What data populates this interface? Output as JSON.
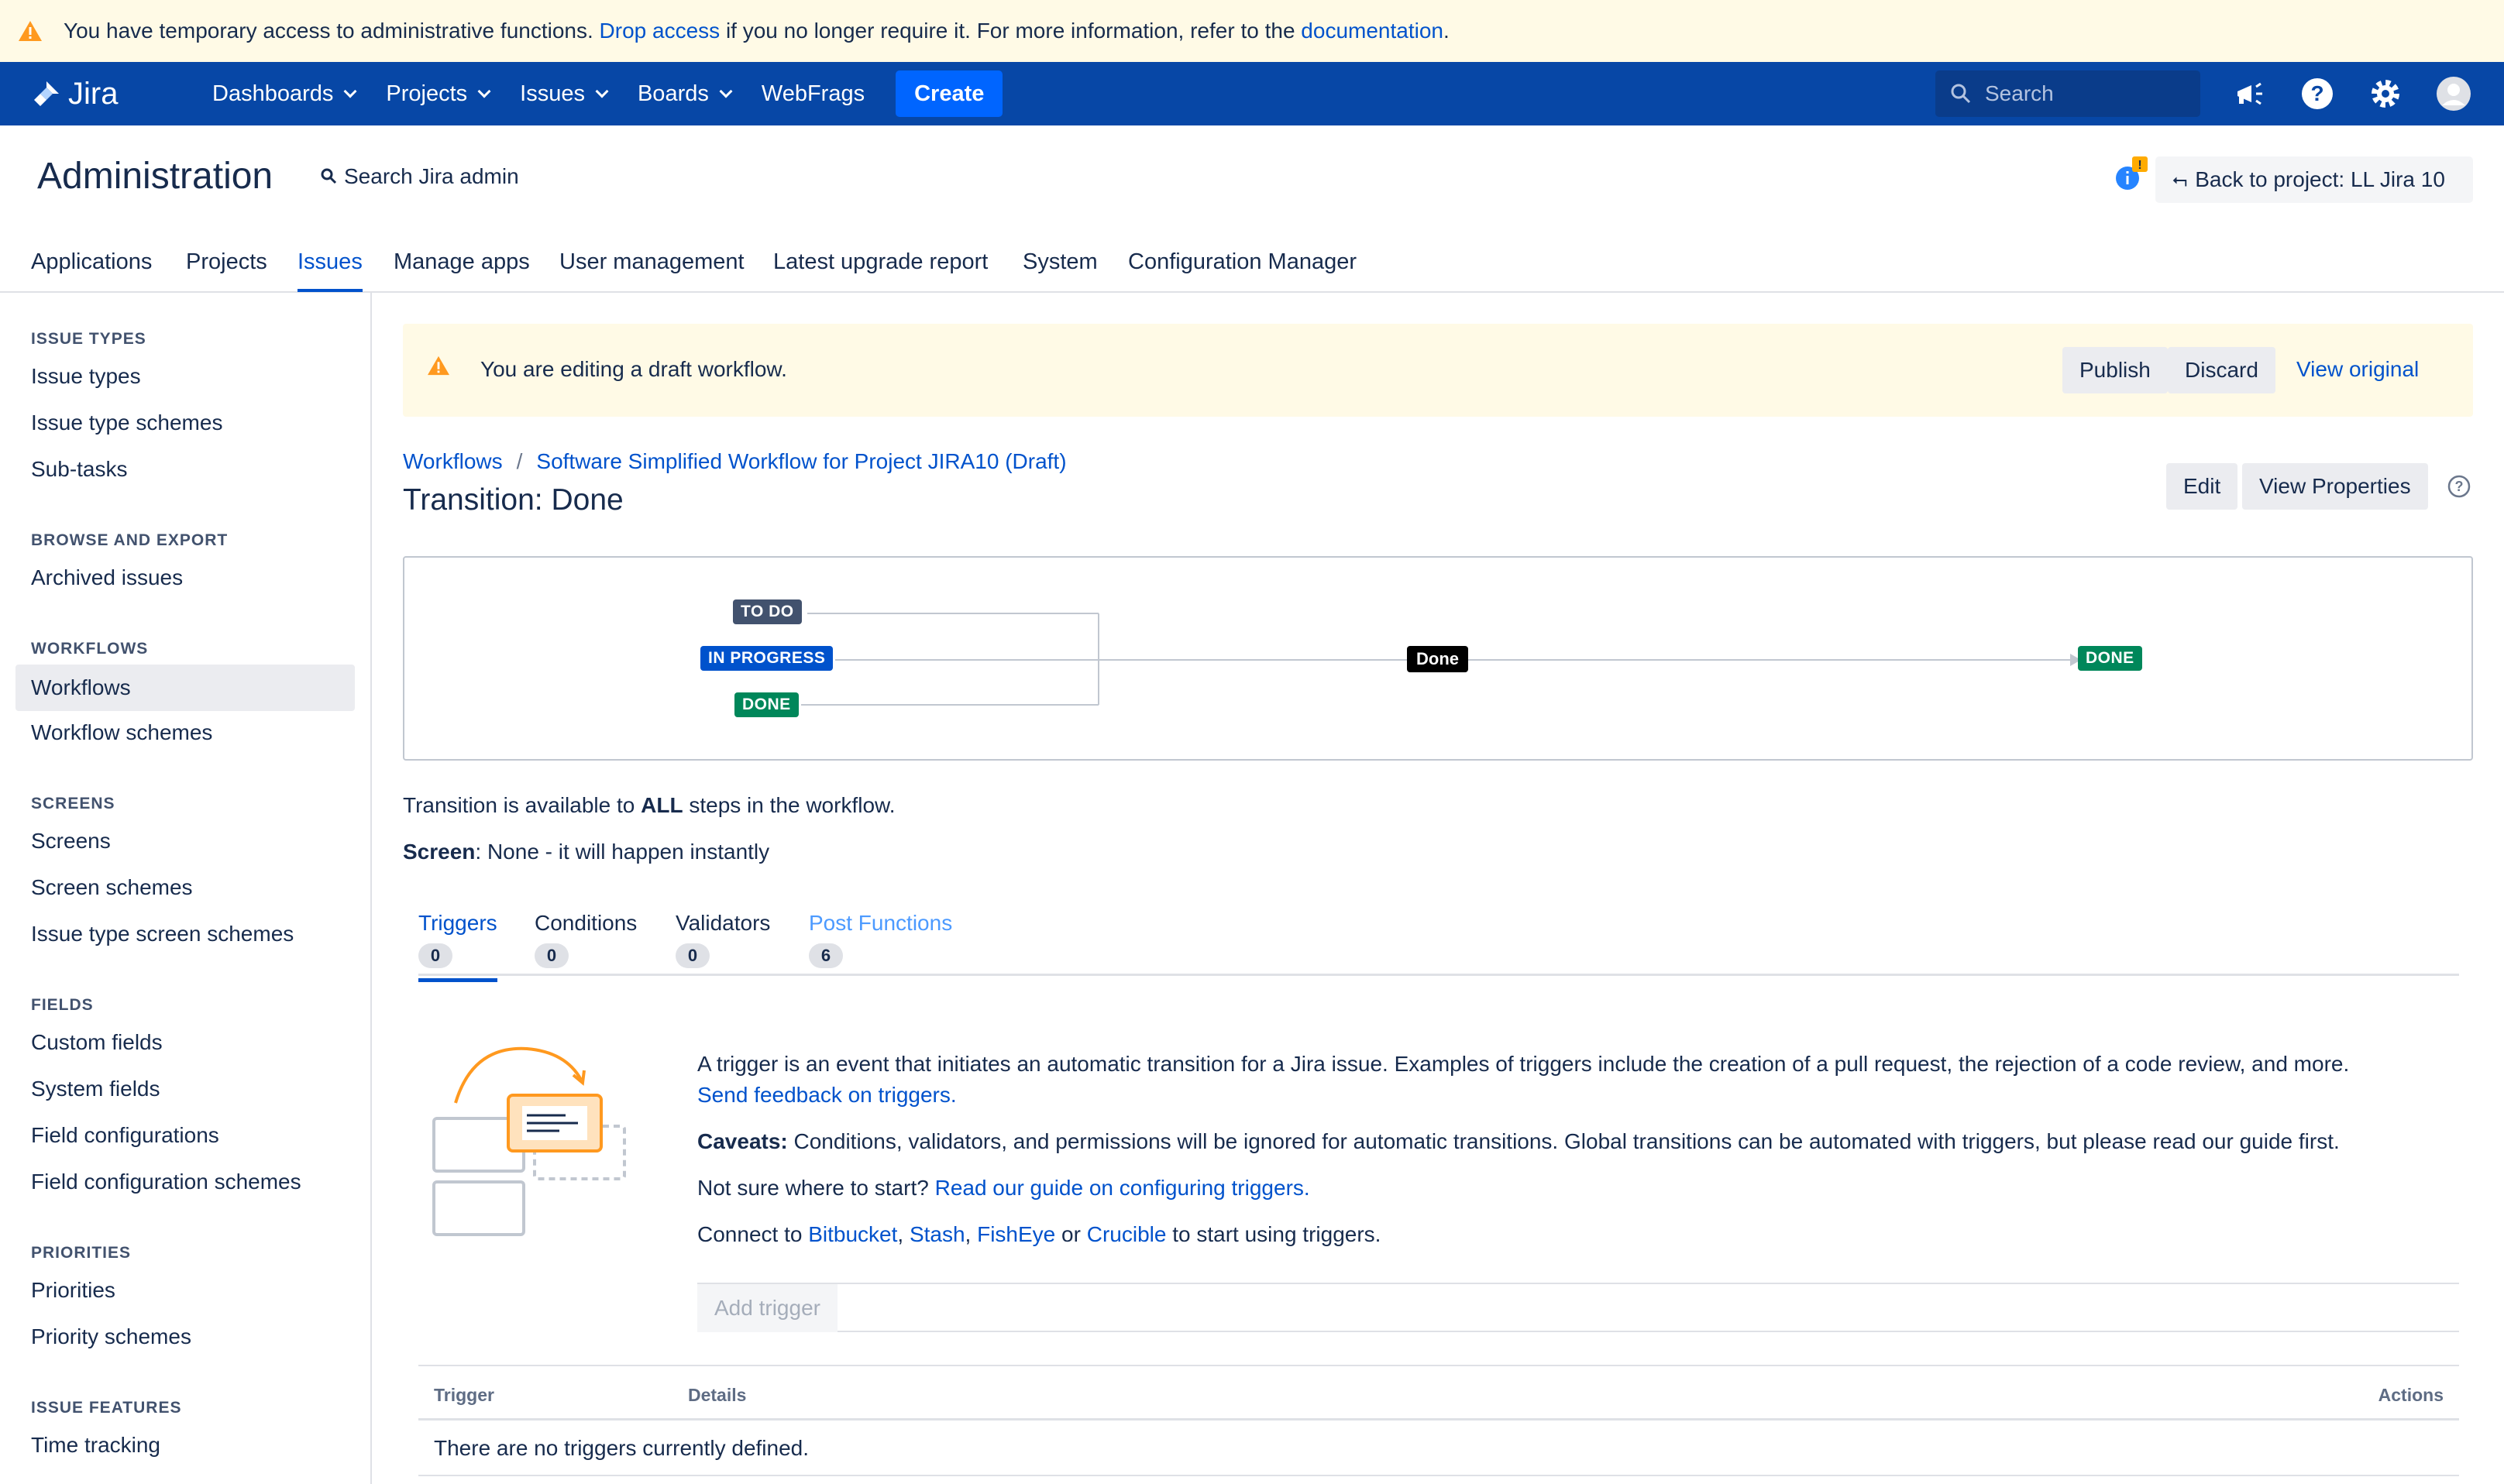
{
  "banner": {
    "text_before": "You have temporary access to administrative functions.",
    "link1": "Drop access",
    "text_middle": "if you no longer require it. For more information, refer to the",
    "link2": "documentation",
    "text_after": "."
  },
  "topnav": {
    "logo_text": "Jira",
    "items": [
      {
        "label": "Dashboards",
        "dropdown": true
      },
      {
        "label": "Projects",
        "dropdown": true
      },
      {
        "label": "Issues",
        "dropdown": true
      },
      {
        "label": "Boards",
        "dropdown": true
      },
      {
        "label": "WebFrags",
        "dropdown": false
      }
    ],
    "create_label": "Create",
    "search_placeholder": "Search",
    "icons": [
      "megaphone-icon",
      "help-icon",
      "settings-icon",
      "avatar"
    ]
  },
  "admin": {
    "title": "Administration",
    "search_label": "Search Jira admin",
    "notif_badge": "!",
    "back_button": "Back to project: LL Jira 10",
    "tabs": [
      "Applications",
      "Projects",
      "Issues",
      "Manage apps",
      "User management",
      "Latest upgrade report",
      "System",
      "Configuration Manager"
    ],
    "active_tab": "Issues"
  },
  "sidebar": {
    "sections": [
      {
        "heading": "ISSUE TYPES",
        "items": [
          "Issue types",
          "Issue type schemes",
          "Sub-tasks"
        ]
      },
      {
        "heading": "BROWSE AND EXPORT",
        "items": [
          "Archived issues"
        ]
      },
      {
        "heading": "WORKFLOWS",
        "items": [
          "Workflows",
          "Workflow schemes"
        ]
      },
      {
        "heading": "SCREENS",
        "items": [
          "Screens",
          "Screen schemes",
          "Issue type screen schemes"
        ]
      },
      {
        "heading": "FIELDS",
        "items": [
          "Custom fields",
          "System fields",
          "Field configurations",
          "Field configuration schemes"
        ]
      },
      {
        "heading": "PRIORITIES",
        "items": [
          "Priorities",
          "Priority schemes"
        ]
      },
      {
        "heading": "ISSUE FEATURES",
        "items": [
          "Time tracking"
        ]
      }
    ],
    "active_item": "Workflows"
  },
  "draft": {
    "message": "You are editing a draft workflow.",
    "publish": "Publish",
    "discard": "Discard",
    "view_original": "View original"
  },
  "breadcrumb": {
    "root": "Workflows",
    "separator": "/",
    "current": "Software Simplified Workflow for Project JIRA10 (Draft)"
  },
  "page_title": "Transition: Done",
  "header_buttons": {
    "edit": "Edit",
    "view_properties": "View Properties"
  },
  "diagram": {
    "from_statuses": [
      "TO DO",
      "IN PROGRESS",
      "DONE"
    ],
    "transition": "Done",
    "to_status": "DONE",
    "colors": {
      "todo": "#42526e",
      "in_progress": "#0052cc",
      "done": "#00875a"
    }
  },
  "availability": {
    "before": "Transition is available to",
    "bold": "ALL",
    "after": "steps in the workflow."
  },
  "screen": {
    "label": "Screen",
    "value": ": None - it will happen instantly"
  },
  "tabs": [
    {
      "label": "Triggers",
      "count": "0",
      "state": "active"
    },
    {
      "label": "Conditions",
      "count": "0",
      "state": "normal"
    },
    {
      "label": "Validators",
      "count": "0",
      "state": "normal"
    },
    {
      "label": "Post Functions",
      "count": "6",
      "state": "hover"
    }
  ],
  "triggers": {
    "intro": "A trigger is an event that initiates an automatic transition for a Jira issue. Examples of triggers include the creation of a pull request, the rejection of a code review, and more.",
    "feedback_link": "Send feedback on triggers.",
    "caveats_label": "Caveats:",
    "caveats_text": "Conditions, validators, and permissions will be ignored for automatic transitions. Global transitions can be automated with triggers, but please read our guide first.",
    "unsure_text": "Not sure where to start?",
    "guide_link": "Read our guide on configuring triggers.",
    "connect_text": "Connect to",
    "connect_links": [
      "Bitbucket",
      "Stash",
      "FishEye",
      "Crucible"
    ],
    "connect_or": "or",
    "connect_after": "to start using triggers.",
    "add_button": "Add trigger",
    "table_headers": {
      "trigger": "Trigger",
      "details": "Details",
      "actions": "Actions"
    },
    "empty_message": "There are no triggers currently defined."
  },
  "accent_colors": {
    "nav_bg": "#0747a6",
    "link": "#0052cc",
    "warning_bg": "#fffae6",
    "warning_icon": "#ff991f"
  }
}
